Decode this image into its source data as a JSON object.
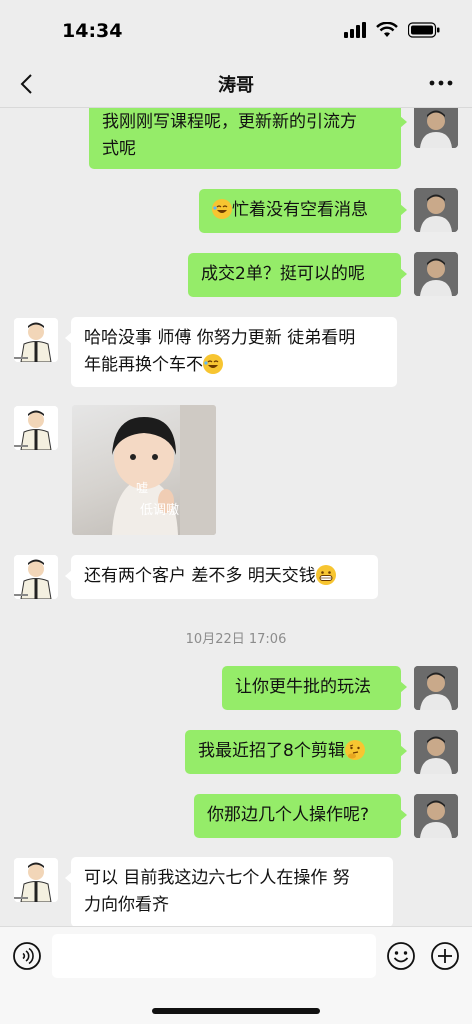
{
  "status_bar": {
    "time": "14:34"
  },
  "nav": {
    "title": "涛哥"
  },
  "messages": [
    {
      "side": "me",
      "lines": [
        "我刚刚写课程呢，更新新的引流方",
        "式呢"
      ]
    },
    {
      "side": "me",
      "text": "忙着没有空看消息",
      "emoji": "laughing-face"
    },
    {
      "side": "me",
      "text": "成交2单？挺可以的呢"
    },
    {
      "side": "other",
      "lines": [
        "哈哈没事 师傅 你努力更新 徒弟看明",
        "年能再换个车不"
      ],
      "emoji": "laughing-face"
    },
    {
      "side": "other",
      "type": "sticker",
      "caption1": "嘘",
      "caption2": "低调嗷"
    },
    {
      "side": "other",
      "text": "还有两个客户 差不多 明天交钱",
      "emoji": "grinning-face"
    },
    {
      "side": "me",
      "text": "让你更牛批的玩法"
    },
    {
      "side": "me",
      "text": "我最近招了8个剪辑",
      "emoji": "thinking-face"
    },
    {
      "side": "me",
      "text": "你那边几个人操作呢?"
    },
    {
      "side": "other",
      "lines": [
        "可以 目前我这边六七个人在操作 努",
        "力向你看齐"
      ]
    }
  ],
  "timestamp": "10月22日 17:06",
  "colors": {
    "bubble_me": "#95ec69",
    "bubble_other": "#ffffff",
    "background": "#ededed"
  },
  "icons": {
    "back": "chevron-left-icon",
    "more": "more-dots-icon",
    "voice": "voice-icon",
    "emoji": "emoji-icon",
    "plus": "plus-icon"
  }
}
